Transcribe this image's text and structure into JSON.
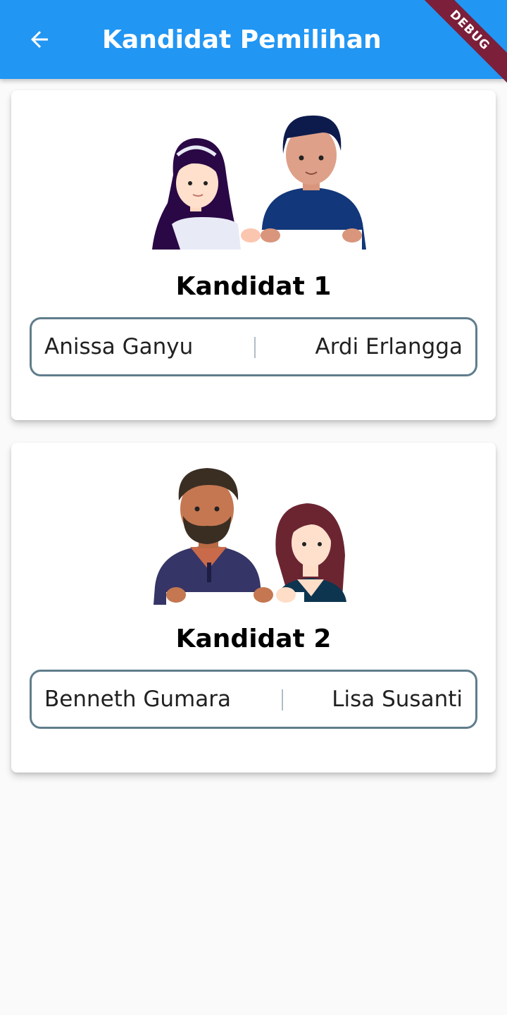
{
  "app_bar": {
    "title": "Kandidat Pemilihan",
    "back_icon": "arrow-back-icon",
    "background_color": "#2196f3"
  },
  "debug_banner": {
    "label": "DEBUG",
    "color": "#7b1f3a"
  },
  "candidates": [
    {
      "title": "Kandidat 1",
      "left_name": "Anissa Ganyu",
      "right_name": "Ardi Erlangga",
      "illustration": "couple-illustration"
    },
    {
      "title": "Kandidat 2",
      "left_name": "Benneth Gumara",
      "right_name": "Lisa Susanti",
      "illustration": "couple-illustration"
    }
  ],
  "colors": {
    "pair_border": "#607d8b"
  }
}
